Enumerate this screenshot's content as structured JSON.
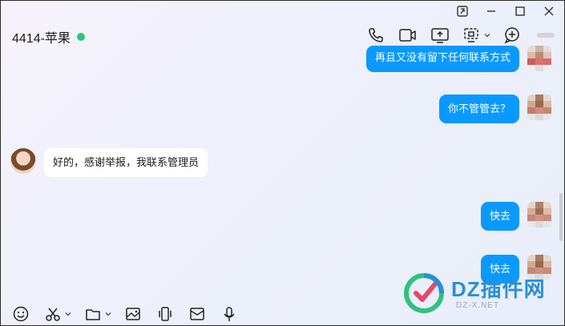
{
  "header": {
    "title": "4414-苹果",
    "status_color": "#27c87a"
  },
  "window_controls": [
    "window-toggle-icon",
    "minimize-icon",
    "maximize-icon",
    "close-icon"
  ],
  "toolbar_top": [
    "phone-icon",
    "video-call-icon",
    "screen-share-icon",
    "remote-desktop-icon",
    "add-icon"
  ],
  "messages": [
    {
      "direction": "out",
      "text": "再且又没有留下任何联系方式"
    },
    {
      "direction": "out",
      "text": "你不管管去？"
    },
    {
      "direction": "in",
      "text": "好的，感谢举报，我联系管理员"
    },
    {
      "direction": "out",
      "text": "快去"
    },
    {
      "direction": "out",
      "text": "快去"
    }
  ],
  "bottom_toolbar": [
    "emoji-icon",
    "scissors-icon",
    "folder-icon",
    "image-icon",
    "shake-icon",
    "envelope-icon",
    "microphone-icon"
  ],
  "watermark": {
    "text": "DZ插件网",
    "sub": "DZ-X.NET"
  },
  "colors": {
    "accent": "#0a99ff",
    "incoming_bg": "#ffffff"
  }
}
